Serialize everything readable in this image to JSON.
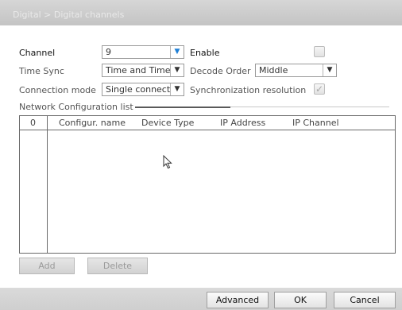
{
  "window": {
    "title": "Digital > Digital channels"
  },
  "form": {
    "channel": {
      "label": "Channel",
      "value": "9"
    },
    "enable": {
      "label": "Enable",
      "checked": false
    },
    "time_sync": {
      "label": "Time Sync",
      "value": "Time and Time"
    },
    "decode_order": {
      "label": "Decode Order",
      "value": "Middle"
    },
    "connection_mode": {
      "label": "Connection mode",
      "value": "Single connect"
    },
    "sync_resolution": {
      "label": "Synchronization resolution",
      "checked": true
    }
  },
  "network_list": {
    "label": "Network Configuration list",
    "columns": [
      "0",
      "Configur. name",
      "Device Type",
      "IP Address",
      "IP Channel"
    ],
    "rows": []
  },
  "buttons": {
    "add": "Add",
    "delete": "Delete",
    "advanced": "Advanced",
    "ok": "OK",
    "cancel": "Cancel"
  },
  "icons": {
    "dropdown": "triangle-down",
    "checkmark": "check",
    "cursor": "mouse-pointer"
  },
  "colors": {
    "accent_arrow": "#1e7fd6",
    "title_text": "#e9e9e9"
  }
}
